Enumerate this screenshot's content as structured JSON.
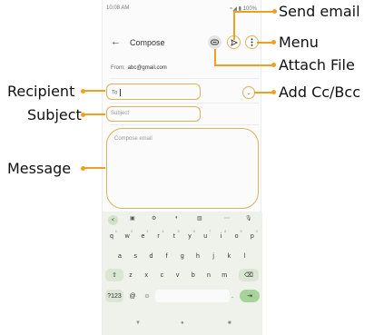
{
  "status_bar": {
    "time": "10:08 AM",
    "right": "≈◢ ▮ 100%"
  },
  "app_bar": {
    "back_icon": "arrow-left-icon",
    "title": "Compose",
    "attach_icon": "paperclip-icon",
    "send_icon": "send-icon",
    "menu_icon": "more-vert-icon"
  },
  "compose": {
    "from_label": "From:",
    "from_value": "abc@gmail.com",
    "to_label": "To",
    "subject_placeholder": "Subject",
    "message_placeholder": "Compose email"
  },
  "keyboard": {
    "toolbar": [
      "<",
      "▣",
      "⚙",
      "◐",
      "▧",
      "⋯",
      "🎙"
    ],
    "row1": [
      {
        "k": "q",
        "h": "1"
      },
      {
        "k": "w",
        "h": "2"
      },
      {
        "k": "e",
        "h": "3"
      },
      {
        "k": "r",
        "h": "4"
      },
      {
        "k": "t",
        "h": "5"
      },
      {
        "k": "y",
        "h": "6"
      },
      {
        "k": "u",
        "h": "7"
      },
      {
        "k": "i",
        "h": "8"
      },
      {
        "k": "o",
        "h": "9"
      },
      {
        "k": "p",
        "h": "0"
      }
    ],
    "row2": [
      "a",
      "s",
      "d",
      "f",
      "g",
      "h",
      "j",
      "k",
      "l"
    ],
    "row3": [
      "⇧",
      "z",
      "x",
      "c",
      "v",
      "b",
      "n",
      "m",
      "⌫"
    ],
    "row4": [
      "?123",
      "@",
      "☺",
      "",
      ".",
      "⇥"
    ],
    "nav": [
      "▼",
      "●",
      "■"
    ]
  },
  "callouts": {
    "send": "Send email",
    "menu": "Menu",
    "attach": "Attach File",
    "cc": "Add Cc/Bcc",
    "recipient": "Recipient",
    "subject": "Subject",
    "message": "Message"
  },
  "colors": {
    "callout": "#f0a020",
    "field_border": "#d9b15f",
    "keyboard_bg": "#eef2ea",
    "enter_key": "#a7d39a"
  }
}
